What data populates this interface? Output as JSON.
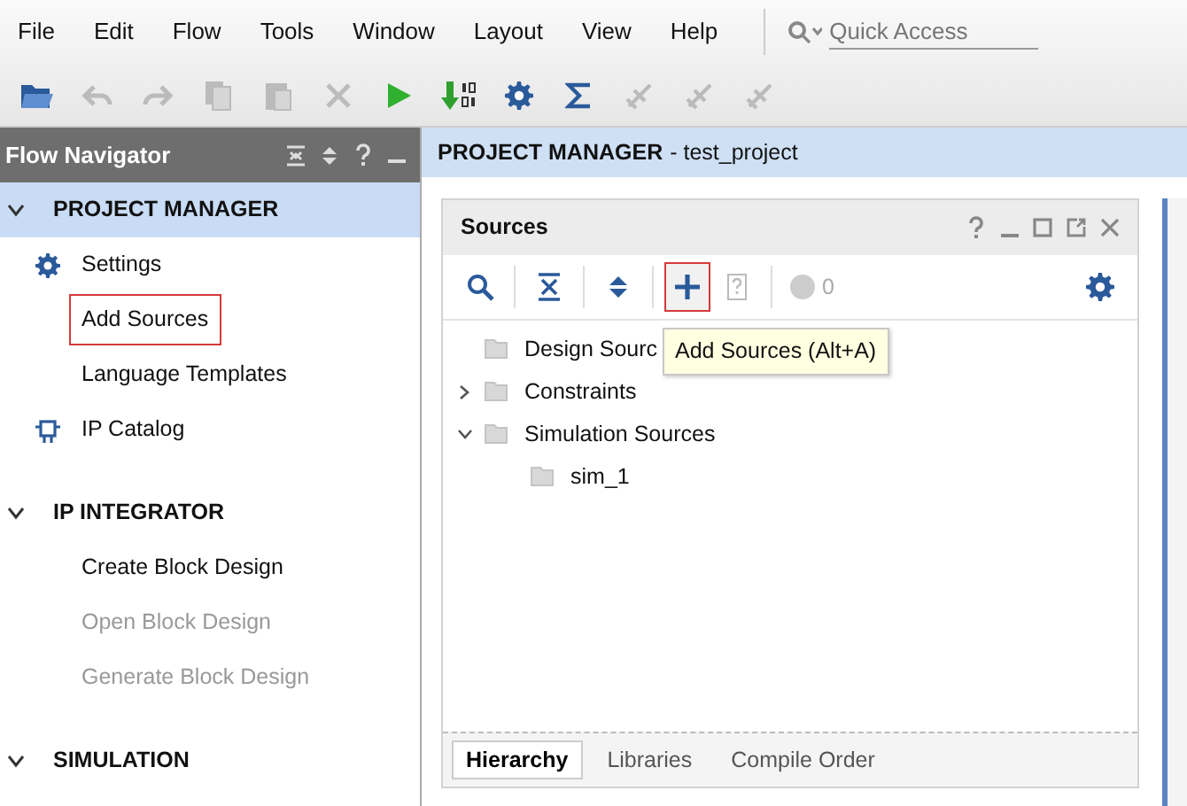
{
  "menu": [
    {
      "label": "File"
    },
    {
      "label": "Edit"
    },
    {
      "label": "Flow"
    },
    {
      "label": "Tools"
    },
    {
      "label": "Window"
    },
    {
      "label": "Layout"
    },
    {
      "label": "View"
    },
    {
      "label": "Help"
    }
  ],
  "quick_access": {
    "placeholder": "Quick Access"
  },
  "toolbar": [
    {
      "kind": "open",
      "disabled": false
    },
    {
      "kind": "undo",
      "disabled": true
    },
    {
      "kind": "redo",
      "disabled": true
    },
    {
      "kind": "copy",
      "disabled": true
    },
    {
      "kind": "paste",
      "disabled": true
    },
    {
      "kind": "delete",
      "disabled": true
    },
    {
      "kind": "run",
      "disabled": false
    },
    {
      "kind": "bitstream",
      "disabled": false
    },
    {
      "kind": "settings",
      "disabled": false
    },
    {
      "kind": "sigma",
      "disabled": false
    },
    {
      "kind": "tool",
      "disabled": true
    },
    {
      "kind": "tool",
      "disabled": true
    },
    {
      "kind": "tool",
      "disabled": true
    }
  ],
  "flow_navigator": {
    "title": "Flow Navigator",
    "sections": [
      {
        "label": "PROJECT MANAGER",
        "expanded": true,
        "selected": true,
        "items": [
          {
            "label": "Settings",
            "kind": "settings",
            "disabled": false,
            "highlighted": false
          },
          {
            "label": "Add Sources",
            "kind": "plain",
            "disabled": false,
            "highlighted": true
          },
          {
            "label": "Language Templates",
            "kind": "plain",
            "disabled": false,
            "highlighted": false
          },
          {
            "label": "IP Catalog",
            "kind": "ip",
            "disabled": false,
            "highlighted": false
          }
        ]
      },
      {
        "label": "IP INTEGRATOR",
        "expanded": true,
        "selected": false,
        "items": [
          {
            "label": "Create Block Design",
            "kind": "plain",
            "disabled": false,
            "highlighted": false
          },
          {
            "label": "Open Block Design",
            "kind": "plain",
            "disabled": true,
            "highlighted": false
          },
          {
            "label": "Generate Block Design",
            "kind": "plain",
            "disabled": true,
            "highlighted": false
          }
        ]
      },
      {
        "label": "SIMULATION",
        "expanded": true,
        "selected": false
      }
    ]
  },
  "main_header": {
    "title": "PROJECT MANAGER",
    "subtitle": "- test_project"
  },
  "sources": {
    "title": "Sources",
    "tools": [
      {
        "kind": "search",
        "highlighted": false,
        "disabled": false
      },
      {
        "kind": "collapse",
        "highlighted": false,
        "disabled": false
      },
      {
        "kind": "expand",
        "highlighted": false,
        "disabled": false
      },
      {
        "kind": "add",
        "highlighted": true,
        "disabled": false
      },
      {
        "kind": "help",
        "highlighted": false,
        "disabled": true
      }
    ],
    "count": "0",
    "tooltip": "Add Sources (Alt+A)",
    "tree": [
      {
        "label": "Design Sourc"
      },
      {
        "label": "Constraints",
        "expanded": false
      },
      {
        "label": "Simulation Sources",
        "expanded": true,
        "children": [
          {
            "label": "sim_1"
          }
        ]
      }
    ],
    "tabs": [
      {
        "label": "Hierarchy",
        "selected": true
      },
      {
        "label": "Libraries",
        "selected": false
      },
      {
        "label": "Compile Order",
        "selected": false
      }
    ]
  }
}
